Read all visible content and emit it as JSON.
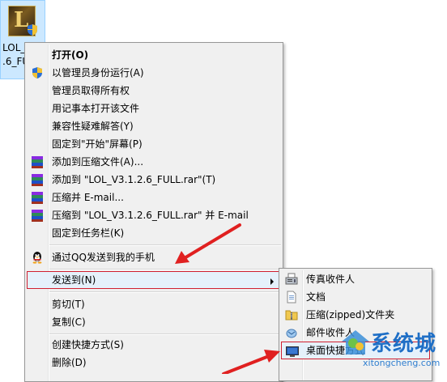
{
  "desktop_icon": {
    "name": "LOL_\n.6_FU"
  },
  "context_menu": {
    "items": [
      {
        "label": "打开(O)",
        "icon": "",
        "bold": true
      },
      {
        "label": "以管理员身份运行(A)",
        "icon": "uac-shield-icon"
      },
      {
        "label": "管理员取得所有权",
        "icon": ""
      },
      {
        "label": "用记事本打开该文件",
        "icon": ""
      },
      {
        "label": "兼容性疑难解答(Y)",
        "icon": ""
      },
      {
        "label": "固定到\"开始\"屏幕(P)",
        "icon": ""
      },
      {
        "label": "添加到压缩文件(A)...",
        "icon": "winrar-icon"
      },
      {
        "label": "添加到 \"LOL_V3.1.2.6_FULL.rar\"(T)",
        "icon": "winrar-icon"
      },
      {
        "label": "压缩并 E-mail...",
        "icon": "winrar-icon"
      },
      {
        "label": "压缩到 \"LOL_V3.1.2.6_FULL.rar\" 并 E-mail",
        "icon": "winrar-icon"
      },
      {
        "label": "固定到任务栏(K)",
        "icon": ""
      },
      {
        "label": "通过QQ发送到我的手机",
        "icon": "qq-penguin-icon"
      },
      {
        "label": "发送到(N)",
        "icon": "",
        "submenu": true
      },
      {
        "label": "剪切(T)",
        "icon": ""
      },
      {
        "label": "复制(C)",
        "icon": ""
      },
      {
        "label": "创建快捷方式(S)",
        "icon": ""
      },
      {
        "label": "删除(D)",
        "icon": ""
      }
    ]
  },
  "send_to_submenu": {
    "items": [
      {
        "label": "传真收件人",
        "icon": "fax-icon"
      },
      {
        "label": "文档",
        "icon": "documents-icon"
      },
      {
        "label": "压缩(zipped)文件夹",
        "icon": "zip-folder-icon"
      },
      {
        "label": "邮件收件人",
        "icon": "mail-recipient-icon"
      },
      {
        "label": "桌面快捷方式",
        "icon": "desktop-icon"
      }
    ]
  },
  "watermark": {
    "brand": "系统城",
    "url": "xitongcheng.com"
  },
  "colors": {
    "highlight_border": "#d02030",
    "arrow": "#e02020",
    "watermark": "#1f6fc6"
  }
}
